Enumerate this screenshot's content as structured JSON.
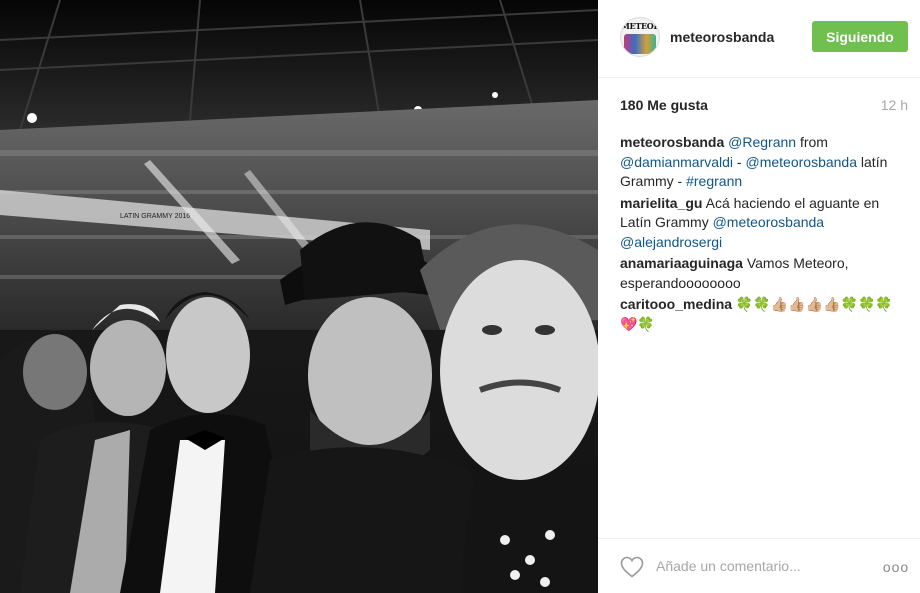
{
  "post": {
    "username": "meteorosbanda",
    "follow_label": "Siguiendo",
    "avatar_text": "METEORO",
    "likes": "180 Me gusta",
    "time": "12 h"
  },
  "comments": [
    {
      "user": "meteorosbanda",
      "parts": [
        {
          "t": " ",
          "m": false
        },
        {
          "t": "@Regrann",
          "m": true
        },
        {
          "t": " from ",
          "m": false
        },
        {
          "t": "@damianmarvaldi",
          "m": true
        },
        {
          "t": " - ",
          "m": false
        },
        {
          "t": "@meteorosbanda",
          "m": true
        },
        {
          "t": " latín Grammy - ",
          "m": false
        },
        {
          "t": "#regrann",
          "m": true
        }
      ]
    },
    {
      "user": "marielita_gu",
      "parts": [
        {
          "t": " Acá haciendo el aguante en Latín Grammy ",
          "m": false
        },
        {
          "t": "@meteorosbanda",
          "m": true
        },
        {
          "t": " ",
          "m": false
        },
        {
          "t": "@alejandrosergi",
          "m": true
        }
      ]
    },
    {
      "user": "anamariaaguinaga",
      "parts": [
        {
          "t": " Vamos Meteoro, esperandoooooooo",
          "m": false
        }
      ]
    },
    {
      "user": "caritooo_medina",
      "parts": [
        {
          "t": " 🍀🍀👍🏼👍🏼👍🏼👍🏼🍀🍀🍀💖🍀",
          "m": false
        }
      ]
    }
  ],
  "footer": {
    "comment_placeholder": "Añade un comentario...",
    "more_label": "ooo",
    "like_icon": "heart-outline-icon"
  },
  "colors": {
    "follow_button": "#70c050",
    "mention": "#125688",
    "muted": "#a5a7aa"
  },
  "photo": {
    "description_icon": "photo-image",
    "banner_text": "LATIN GRAMMY 2016"
  }
}
